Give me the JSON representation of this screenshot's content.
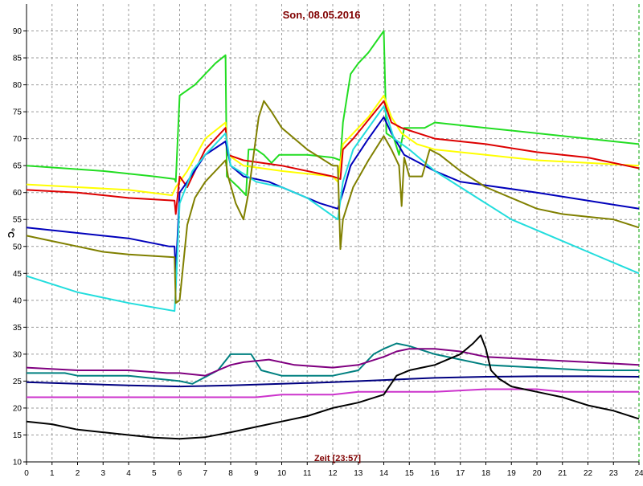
{
  "chart_data": {
    "type": "line",
    "title": "Son, 08.05.2016",
    "xlabel": "Zeit [23:57]",
    "ylabel": "°C",
    "xlim": [
      0,
      24
    ],
    "ylim": [
      10,
      95
    ],
    "x_ticks": [
      0,
      1,
      2,
      3,
      4,
      5,
      6,
      7,
      8,
      9,
      10,
      11,
      12,
      13,
      14,
      15,
      16,
      17,
      18,
      19,
      20,
      21,
      22,
      23,
      24
    ],
    "y_ticks": [
      10,
      15,
      20,
      25,
      30,
      35,
      40,
      45,
      50,
      55,
      60,
      65,
      70,
      75,
      80,
      85,
      90
    ],
    "grid": true,
    "colors": {
      "title": "#800000",
      "xlabel": "#800000",
      "grid": "#9a9a9a",
      "axis": "#000000",
      "end_line": "#00a000"
    },
    "series": [
      {
        "color": "#22dd22",
        "points": [
          [
            0,
            65
          ],
          [
            3,
            64
          ],
          [
            5,
            63
          ],
          [
            5.8,
            62.5
          ],
          [
            5.85,
            62
          ],
          [
            6,
            78
          ],
          [
            6.3,
            79
          ],
          [
            6.6,
            80
          ],
          [
            7,
            82
          ],
          [
            7.4,
            84
          ],
          [
            7.8,
            85.5
          ],
          [
            7.85,
            63
          ],
          [
            8.3,
            61
          ],
          [
            8.6,
            59.5
          ],
          [
            8.7,
            68
          ],
          [
            9,
            68
          ],
          [
            9.3,
            67
          ],
          [
            9.6,
            65.5
          ],
          [
            9.9,
            67
          ],
          [
            11,
            67
          ],
          [
            12,
            66.5
          ],
          [
            12.3,
            66
          ],
          [
            12.4,
            73
          ],
          [
            12.7,
            82
          ],
          [
            13,
            84
          ],
          [
            13.4,
            86
          ],
          [
            14,
            90
          ],
          [
            14.1,
            71
          ],
          [
            14.4,
            70
          ],
          [
            14.6,
            67
          ],
          [
            14.8,
            72
          ],
          [
            15.6,
            72
          ],
          [
            16,
            73
          ],
          [
            18,
            72
          ],
          [
            20,
            71
          ],
          [
            22,
            70
          ],
          [
            24,
            69
          ]
        ]
      },
      {
        "color": "#ffff00",
        "points": [
          [
            0,
            61.5
          ],
          [
            2,
            61
          ],
          [
            4,
            60.5
          ],
          [
            5.7,
            59.5
          ],
          [
            5.85,
            61
          ],
          [
            6.3,
            64
          ],
          [
            7,
            70
          ],
          [
            7.8,
            73
          ],
          [
            7.9,
            67
          ],
          [
            8.5,
            65
          ],
          [
            10,
            64
          ],
          [
            12,
            63
          ],
          [
            12.2,
            62
          ],
          [
            12.4,
            69
          ],
          [
            12.8,
            71
          ],
          [
            13.4,
            74
          ],
          [
            14,
            78
          ],
          [
            14.3,
            74
          ],
          [
            14.7,
            71
          ],
          [
            15.3,
            69
          ],
          [
            16,
            68
          ],
          [
            18,
            67
          ],
          [
            20,
            66
          ],
          [
            22,
            65.5
          ],
          [
            24,
            65
          ]
        ]
      },
      {
        "color": "#dd0000",
        "points": [
          [
            0,
            60.5
          ],
          [
            2,
            60
          ],
          [
            4,
            59
          ],
          [
            5.8,
            58.5
          ],
          [
            5.85,
            56
          ],
          [
            6,
            63
          ],
          [
            6.3,
            61
          ],
          [
            7,
            68
          ],
          [
            7.8,
            72
          ],
          [
            7.9,
            67
          ],
          [
            8.5,
            66
          ],
          [
            10,
            65
          ],
          [
            12,
            63
          ],
          [
            12.3,
            62.5
          ],
          [
            12.4,
            68
          ],
          [
            12.8,
            70
          ],
          [
            13.4,
            73.5
          ],
          [
            14,
            77
          ],
          [
            14.3,
            73
          ],
          [
            14.7,
            72
          ],
          [
            16,
            70
          ],
          [
            18,
            69
          ],
          [
            20,
            67.5
          ],
          [
            22,
            66.5
          ],
          [
            24,
            64.5
          ]
        ]
      },
      {
        "color": "#0000bb",
        "points": [
          [
            0,
            53.5
          ],
          [
            2,
            52.5
          ],
          [
            4,
            51.5
          ],
          [
            5.6,
            50
          ],
          [
            5.8,
            50
          ],
          [
            5.85,
            45
          ],
          [
            6,
            60
          ],
          [
            6.3,
            62
          ],
          [
            7,
            67
          ],
          [
            7.8,
            69.5
          ],
          [
            8,
            65
          ],
          [
            8.5,
            63
          ],
          [
            9.5,
            62
          ],
          [
            10.5,
            60
          ],
          [
            11.5,
            58
          ],
          [
            12.2,
            57
          ],
          [
            12.4,
            60
          ],
          [
            12.7,
            65
          ],
          [
            13.4,
            70
          ],
          [
            14,
            74
          ],
          [
            14.3,
            71
          ],
          [
            14.8,
            67
          ],
          [
            16,
            64
          ],
          [
            17,
            62
          ],
          [
            18.5,
            61
          ],
          [
            20,
            60
          ],
          [
            22,
            58.5
          ],
          [
            24,
            57
          ]
        ]
      },
      {
        "color": "#22dddd",
        "points": [
          [
            0,
            44.5
          ],
          [
            1,
            43
          ],
          [
            2,
            41.5
          ],
          [
            3,
            40.5
          ],
          [
            4,
            39.5
          ],
          [
            5.8,
            38
          ],
          [
            5.85,
            42
          ],
          [
            6,
            58
          ],
          [
            6.5,
            64
          ],
          [
            7,
            67
          ],
          [
            7.8,
            71
          ],
          [
            8,
            65
          ],
          [
            9,
            62
          ],
          [
            10,
            61
          ],
          [
            11,
            59
          ],
          [
            12.2,
            55
          ],
          [
            12.4,
            62
          ],
          [
            12.8,
            68
          ],
          [
            13.4,
            72
          ],
          [
            14,
            76
          ],
          [
            14.4,
            70
          ],
          [
            15,
            68
          ],
          [
            16,
            64
          ],
          [
            17,
            61
          ],
          [
            18,
            58
          ],
          [
            19,
            55
          ],
          [
            20,
            53
          ],
          [
            21,
            51
          ],
          [
            22,
            49
          ],
          [
            23,
            47
          ],
          [
            24,
            45
          ]
        ]
      },
      {
        "color": "#808000",
        "points": [
          [
            0,
            52
          ],
          [
            1,
            51
          ],
          [
            2,
            50
          ],
          [
            3,
            49
          ],
          [
            4,
            48.5
          ],
          [
            5.8,
            48
          ],
          [
            5.85,
            39.5
          ],
          [
            6,
            40
          ],
          [
            6.3,
            54
          ],
          [
            6.6,
            59
          ],
          [
            7,
            62
          ],
          [
            7.8,
            66
          ],
          [
            7.9,
            63
          ],
          [
            8.2,
            58
          ],
          [
            8.5,
            55
          ],
          [
            8.7,
            60
          ],
          [
            9.1,
            74
          ],
          [
            9.3,
            77
          ],
          [
            9.6,
            75
          ],
          [
            10,
            72
          ],
          [
            10.5,
            70
          ],
          [
            11,
            68
          ],
          [
            12,
            65
          ],
          [
            12.2,
            65
          ],
          [
            12.3,
            49.5
          ],
          [
            12.4,
            55
          ],
          [
            12.8,
            61
          ],
          [
            13.4,
            66
          ],
          [
            14,
            70.5
          ],
          [
            14.3,
            68
          ],
          [
            14.6,
            65
          ],
          [
            14.7,
            57.5
          ],
          [
            14.8,
            66.5
          ],
          [
            15,
            63
          ],
          [
            15.5,
            63
          ],
          [
            15.8,
            68
          ],
          [
            16.2,
            67
          ],
          [
            17,
            64
          ],
          [
            18,
            61
          ],
          [
            19,
            59
          ],
          [
            20,
            57
          ],
          [
            21,
            56
          ],
          [
            22,
            55.5
          ],
          [
            23,
            55
          ],
          [
            24,
            53.5
          ]
        ]
      },
      {
        "color": "#008080",
        "points": [
          [
            0,
            26.5
          ],
          [
            1.5,
            26.5
          ],
          [
            2,
            26
          ],
          [
            4,
            26
          ],
          [
            5,
            25.5
          ],
          [
            6,
            25
          ],
          [
            6.5,
            24.5
          ],
          [
            7.5,
            27
          ],
          [
            8,
            30
          ],
          [
            8.8,
            30
          ],
          [
            9.2,
            27
          ],
          [
            10,
            26
          ],
          [
            12,
            26
          ],
          [
            13,
            27
          ],
          [
            13.6,
            30
          ],
          [
            14,
            31
          ],
          [
            14.5,
            32
          ],
          [
            15,
            31.5
          ],
          [
            16,
            30
          ],
          [
            17,
            29
          ],
          [
            18,
            28
          ],
          [
            20,
            27.5
          ],
          [
            22,
            27
          ],
          [
            24,
            27
          ]
        ]
      },
      {
        "color": "#800080",
        "points": [
          [
            0,
            27.5
          ],
          [
            2,
            27
          ],
          [
            4,
            27
          ],
          [
            5.5,
            26.5
          ],
          [
            6,
            26.5
          ],
          [
            7,
            26
          ],
          [
            7.5,
            27
          ],
          [
            8,
            28
          ],
          [
            8.5,
            28.5
          ],
          [
            9.5,
            29
          ],
          [
            10.5,
            28
          ],
          [
            12,
            27.5
          ],
          [
            13,
            28
          ],
          [
            14,
            29.5
          ],
          [
            14.5,
            30.5
          ],
          [
            15,
            31
          ],
          [
            16,
            31
          ],
          [
            17,
            30.5
          ],
          [
            18,
            29.5
          ],
          [
            20,
            29
          ],
          [
            22,
            28.5
          ],
          [
            24,
            28
          ]
        ]
      },
      {
        "color": "#000080",
        "points": [
          [
            0,
            24.8
          ],
          [
            2,
            24.5
          ],
          [
            4,
            24.2
          ],
          [
            6,
            24
          ],
          [
            8,
            24.2
          ],
          [
            10,
            24.5
          ],
          [
            12,
            24.8
          ],
          [
            14,
            25.2
          ],
          [
            16,
            25.6
          ],
          [
            18,
            25.8
          ],
          [
            20,
            25.9
          ],
          [
            22,
            25.9
          ],
          [
            24,
            25.8
          ]
        ]
      },
      {
        "color": "#cc33cc",
        "points": [
          [
            0,
            22
          ],
          [
            5,
            22
          ],
          [
            9,
            22
          ],
          [
            10,
            22.5
          ],
          [
            12,
            22.5
          ],
          [
            13,
            23
          ],
          [
            16,
            23
          ],
          [
            18,
            23.5
          ],
          [
            20,
            23.5
          ],
          [
            21,
            23
          ],
          [
            24,
            23
          ]
        ]
      },
      {
        "color": "#000000",
        "points": [
          [
            0,
            17.5
          ],
          [
            1,
            17
          ],
          [
            2,
            16
          ],
          [
            3,
            15.5
          ],
          [
            4,
            15
          ],
          [
            5,
            14.5
          ],
          [
            6,
            14.3
          ],
          [
            7,
            14.6
          ],
          [
            8,
            15.5
          ],
          [
            9,
            16.5
          ],
          [
            10,
            17.5
          ],
          [
            11,
            18.5
          ],
          [
            12,
            20
          ],
          [
            13,
            21
          ],
          [
            14,
            22.5
          ],
          [
            14.5,
            26
          ],
          [
            15,
            27
          ],
          [
            15.5,
            27.5
          ],
          [
            16,
            28
          ],
          [
            16.5,
            29
          ],
          [
            17,
            30
          ],
          [
            17.5,
            32
          ],
          [
            17.8,
            33.5
          ],
          [
            18,
            31
          ],
          [
            18.2,
            27
          ],
          [
            18.5,
            25.5
          ],
          [
            19,
            24
          ],
          [
            19.5,
            23.5
          ],
          [
            20,
            23
          ],
          [
            21,
            22
          ],
          [
            22,
            20.5
          ],
          [
            23,
            19.5
          ],
          [
            24,
            18
          ]
        ]
      }
    ]
  }
}
